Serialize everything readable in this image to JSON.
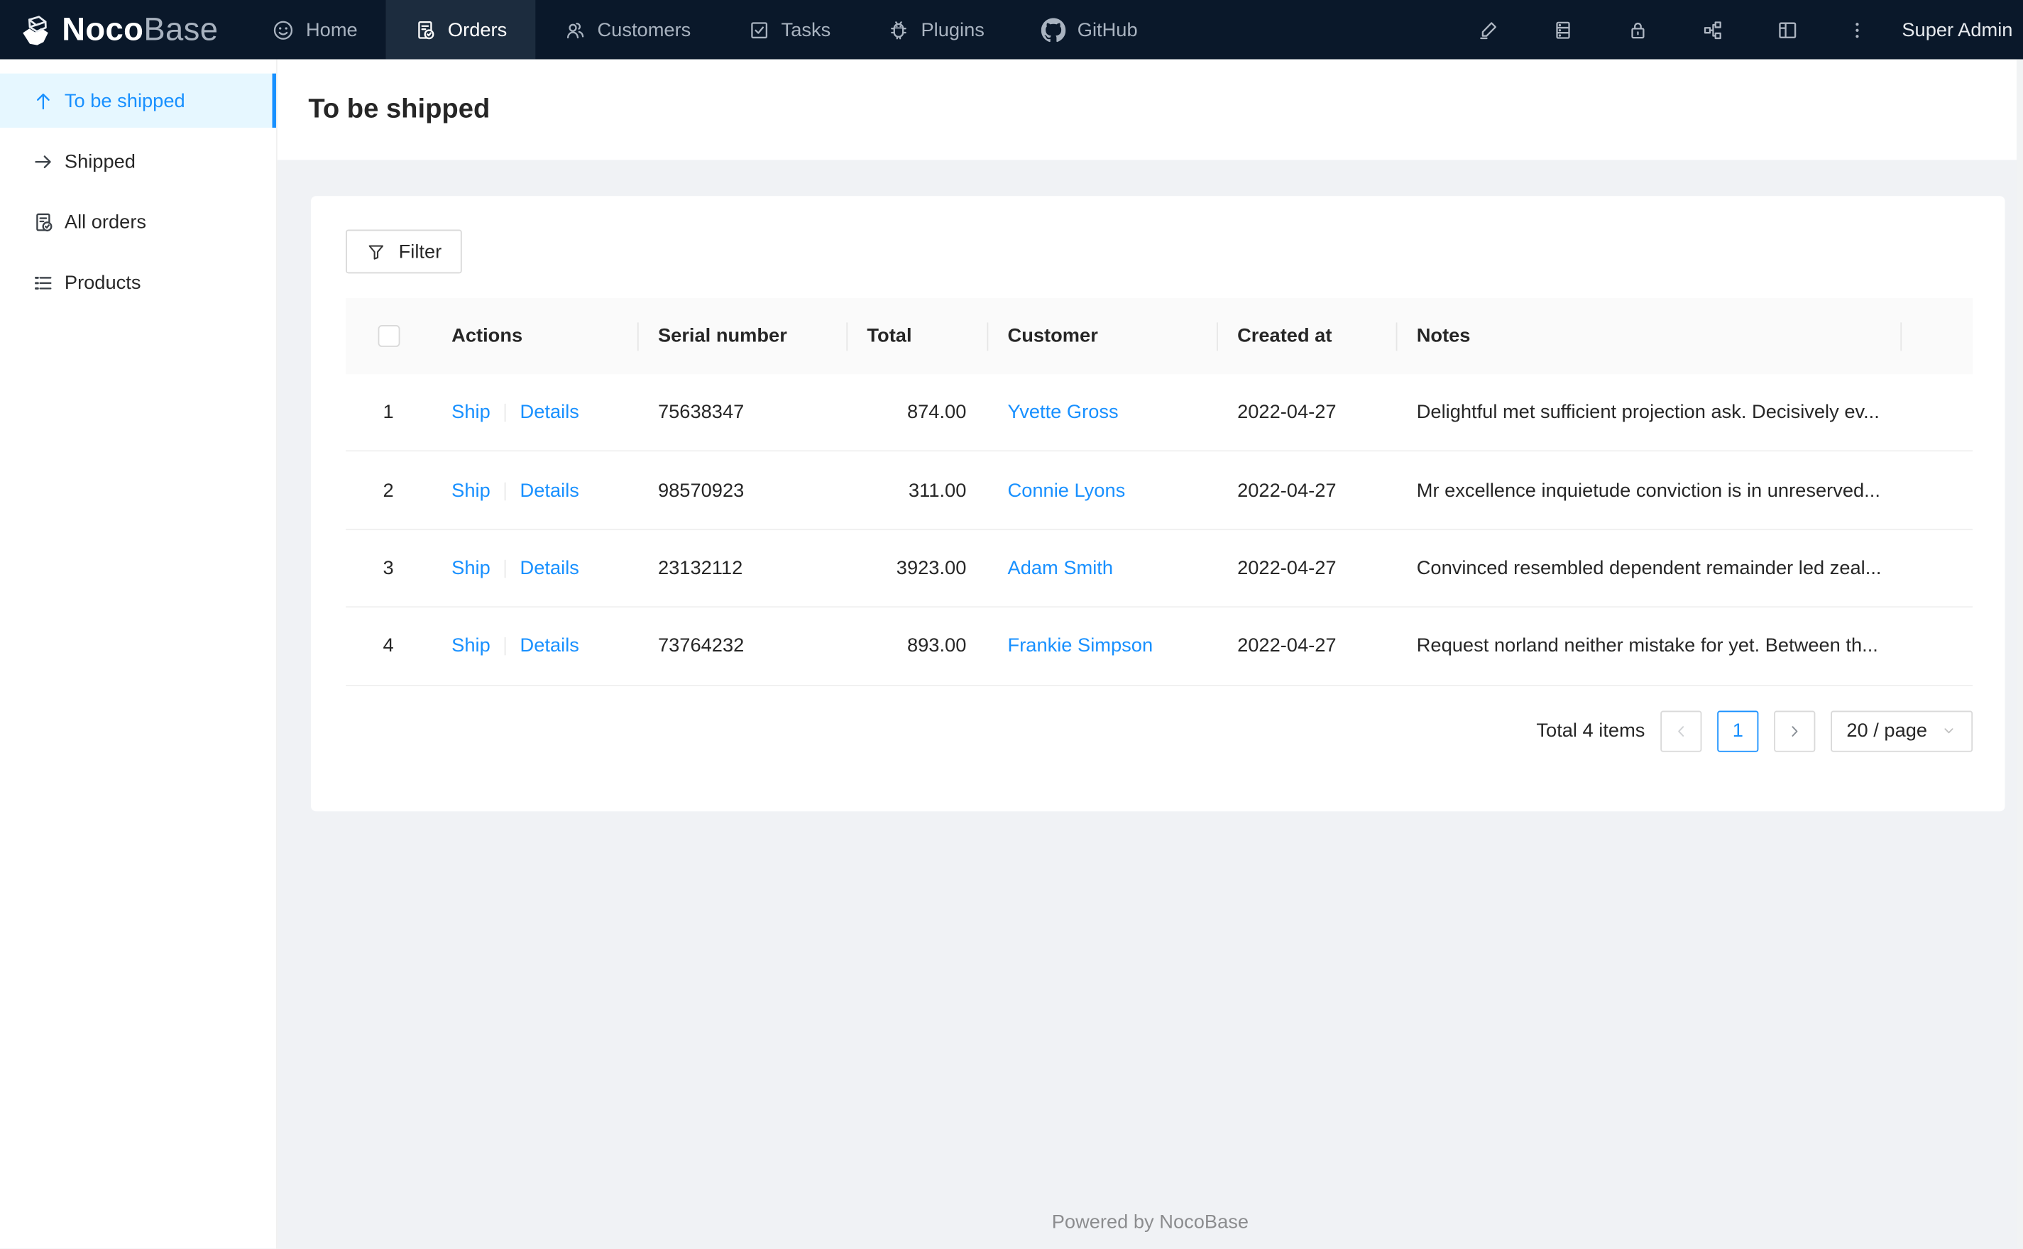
{
  "navbar": {
    "logo": {
      "noco": "Noco",
      "base": "Base",
      "mark": "nocobase-logo-mark"
    },
    "items": [
      {
        "label": "Home",
        "icon": "smiley-icon",
        "active": false
      },
      {
        "label": "Orders",
        "icon": "file-done-icon",
        "active": true
      },
      {
        "label": "Customers",
        "icon": "team-icon",
        "active": false
      },
      {
        "label": "Tasks",
        "icon": "check-square-icon",
        "active": false
      },
      {
        "label": "Plugins",
        "icon": "bug-icon",
        "active": false
      },
      {
        "label": "GitHub",
        "icon": "github-icon",
        "active": false
      }
    ],
    "right_icons": [
      "highlighter-icon",
      "database-icon",
      "lock-icon",
      "apartment-icon",
      "layout-icon",
      "more-icon"
    ],
    "user": "Super Admin"
  },
  "sidebar": {
    "items": [
      {
        "label": "To be shipped",
        "icon": "arrow-up-icon",
        "active": true
      },
      {
        "label": "Shipped",
        "icon": "arrow-right-icon",
        "active": false
      },
      {
        "label": "All orders",
        "icon": "file-done-icon",
        "active": false
      },
      {
        "label": "Products",
        "icon": "list-icon",
        "active": false
      }
    ]
  },
  "page": {
    "title": "To be shipped"
  },
  "toolbar": {
    "filter_label": "Filter"
  },
  "table": {
    "columns": [
      "Actions",
      "Serial number",
      "Total",
      "Customer",
      "Created at",
      "Notes"
    ],
    "actions": {
      "ship": "Ship",
      "details": "Details"
    },
    "rows": [
      {
        "index": "1",
        "serial": "75638347",
        "total": "874.00",
        "customer": "Yvette Gross",
        "created_at": "2022-04-27",
        "notes": "Delightful met sufficient projection ask. Decisively ev..."
      },
      {
        "index": "2",
        "serial": "98570923",
        "total": "311.00",
        "customer": "Connie Lyons",
        "created_at": "2022-04-27",
        "notes": "Mr excellence inquietude conviction is in unreserved..."
      },
      {
        "index": "3",
        "serial": "23132112",
        "total": "3923.00",
        "customer": "Adam Smith",
        "created_at": "2022-04-27",
        "notes": "Convinced resembled dependent remainder led zeal..."
      },
      {
        "index": "4",
        "serial": "73764232",
        "total": "893.00",
        "customer": "Frankie Simpson",
        "created_at": "2022-04-27",
        "notes": "Request norland neither mistake for yet. Between th..."
      }
    ]
  },
  "pagination": {
    "total_text": "Total 4 items",
    "current_page": "1",
    "page_size": "20 / page"
  },
  "footer": {
    "text": "Powered by NocoBase"
  },
  "colors": {
    "primary": "#1890ff",
    "navbar_bg": "#0a182a",
    "navbar_active_bg": "#1c2c3e",
    "sidebar_active_bg": "#e6f7ff",
    "content_bg": "#f0f2f5",
    "table_header_bg": "#fafafa",
    "border": "#f0f0f0"
  }
}
